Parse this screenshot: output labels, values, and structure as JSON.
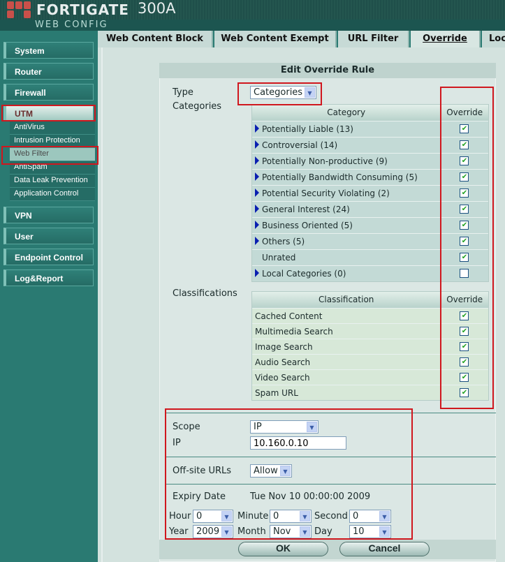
{
  "header": {
    "brand": "FortiGate",
    "model": "300A",
    "subtitle": "WEB CONFIG"
  },
  "sidebar": {
    "items": [
      {
        "label": "System"
      },
      {
        "label": "Router"
      },
      {
        "label": "Firewall"
      },
      {
        "label": "UTM"
      },
      {
        "label": "VPN"
      },
      {
        "label": "User"
      },
      {
        "label": "Endpoint Control"
      },
      {
        "label": "Log&Report"
      }
    ],
    "utm_sub": [
      {
        "label": "AntiVirus"
      },
      {
        "label": "Intrusion Protection"
      },
      {
        "label": "Web Filter",
        "selected": true
      },
      {
        "label": "AntiSpam"
      },
      {
        "label": "Data Leak Prevention"
      },
      {
        "label": "Application Control"
      }
    ]
  },
  "tabs": [
    {
      "label": "Web Content Block"
    },
    {
      "label": "Web Content Exempt"
    },
    {
      "label": "URL Filter"
    },
    {
      "label": "Override",
      "active": true
    },
    {
      "label": "Loc"
    }
  ],
  "form": {
    "title": "Edit Override Rule",
    "type_label": "Type",
    "type_value": "Categories",
    "categories_label": "Categories",
    "classifications_label": "Classifications",
    "cat_header": "Category",
    "override_header": "Override",
    "cls_header": "Classification",
    "categories": [
      {
        "name": "Potentially Liable (13)",
        "expand": true,
        "checked": true
      },
      {
        "name": "Controversial (14)",
        "expand": true,
        "checked": true
      },
      {
        "name": "Potentially Non-productive (9)",
        "expand": true,
        "checked": true
      },
      {
        "name": "Potentially Bandwidth Consuming (5)",
        "expand": true,
        "checked": true
      },
      {
        "name": "Potential Security Violating (2)",
        "expand": true,
        "checked": true
      },
      {
        "name": "General Interest (24)",
        "expand": true,
        "checked": true
      },
      {
        "name": "Business Oriented (5)",
        "expand": true,
        "checked": true
      },
      {
        "name": "Others (5)",
        "expand": true,
        "checked": true
      },
      {
        "name": "Unrated",
        "expand": false,
        "checked": true
      },
      {
        "name": "Local Categories (0)",
        "expand": true,
        "checked": false
      }
    ],
    "classifications": [
      {
        "name": "Cached Content",
        "checked": true
      },
      {
        "name": "Multimedia Search",
        "checked": true
      },
      {
        "name": "Image Search",
        "checked": true
      },
      {
        "name": "Audio Search",
        "checked": true
      },
      {
        "name": "Video Search",
        "checked": true
      },
      {
        "name": "Spam URL",
        "checked": true
      }
    ],
    "scope_label": "Scope",
    "scope_value": "IP",
    "ip_label": "IP",
    "ip_value": "10.160.0.10",
    "offsite_label": "Off-site URLs",
    "offsite_value": "Allow",
    "expiry_label": "Expiry Date",
    "expiry_value": "Tue Nov 10 00:00:00 2009",
    "hour_label": "Hour",
    "hour": "0",
    "minute_label": "Minute",
    "minute": "0",
    "second_label": "Second",
    "second": "0",
    "year_label": "Year",
    "year": "2009",
    "month_label": "Month",
    "month": "Nov",
    "day_label": "Day",
    "day": "10",
    "ok": "OK",
    "cancel": "Cancel"
  },
  "colors": {
    "annotation": "#d0171e",
    "sidebar": "#2a7a72"
  }
}
